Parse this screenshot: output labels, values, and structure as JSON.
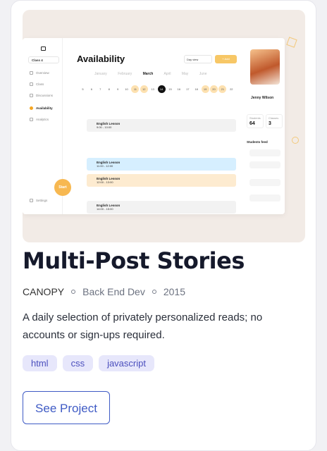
{
  "card": {
    "title": "Multi-Post Stories",
    "meta": {
      "company": "CANOPY",
      "role": "Back End Dev",
      "year": "2015"
    },
    "description": "A daily selection of privately personalized reads; no accounts or sign-ups required.",
    "tags": [
      "html",
      "css",
      "javascript"
    ],
    "button_label": "See Project"
  },
  "preview": {
    "app_title": "Availability",
    "class_select": "Class 4",
    "nav": [
      "Overview",
      "Class",
      "Discussions",
      "Availability",
      "Analytics"
    ],
    "settings": "Settings",
    "start_label": "Start",
    "view_select": "Day view",
    "add_label": "+ Add",
    "months": [
      "January",
      "February",
      "March",
      "April",
      "May",
      "June"
    ],
    "current_month": "March",
    "days": [
      "5",
      "6",
      "7",
      "8",
      "9",
      "10",
      "11",
      "12",
      "13",
      "14",
      "15",
      "16",
      "17",
      "18",
      "19",
      "20",
      "21",
      "22"
    ],
    "today": "14",
    "events": [
      {
        "title": "English Lesson",
        "time": "9:00 - 10:00",
        "style": "grey"
      },
      {
        "title": "English Lesson",
        "time": "11:00 - 12:00",
        "style": "blue"
      },
      {
        "title": "English Lesson",
        "time": "12:00 - 13:00",
        "style": "peach"
      },
      {
        "title": "English Lesson",
        "time": "14:00 - 15:00",
        "style": "grey"
      }
    ],
    "profile_name": "Jenny Wilson",
    "stats": [
      {
        "label": "Students",
        "value": "64"
      },
      {
        "label": "Classes",
        "value": "3"
      }
    ],
    "feed_title": "Students feed"
  },
  "colors": {
    "accent": "#3f5bc5",
    "tag_bg": "#e7e7fb",
    "orange": "#f7b851"
  }
}
